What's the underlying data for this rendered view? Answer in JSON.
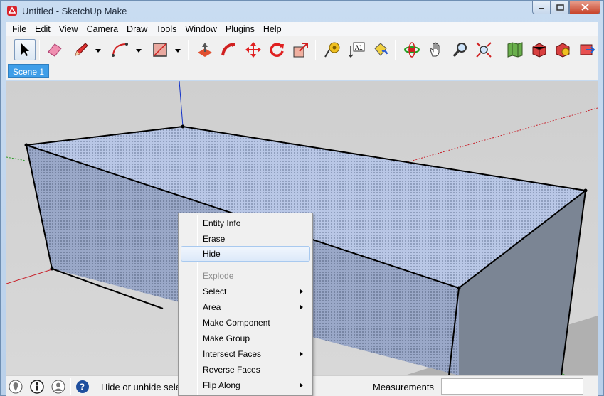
{
  "window": {
    "title": "Untitled - SketchUp Make"
  },
  "menubar": {
    "items": [
      "File",
      "Edit",
      "View",
      "Camera",
      "Draw",
      "Tools",
      "Window",
      "Plugins",
      "Help"
    ]
  },
  "toolbar": {
    "tools": [
      "select-arrow-icon",
      "eraser-icon",
      "pencil-line-icon",
      "arc-icon",
      "rectangle-icon",
      "push-pull-icon",
      "follow-me-icon",
      "move-icon",
      "rotate-icon",
      "scale-icon",
      "tape-measure-icon",
      "text-label-icon",
      "paint-bucket-icon",
      "orbit-icon",
      "pan-hand-icon",
      "zoom-icon",
      "zoom-extents-icon",
      "map-location-icon",
      "get-models-icon",
      "share-model-icon",
      "extension-warehouse-icon"
    ]
  },
  "scenes": {
    "tabs": [
      "Scene 1"
    ]
  },
  "context_menu": {
    "items": [
      {
        "label": "Entity Info",
        "submenu": false,
        "disabled": false,
        "highlighted": false
      },
      {
        "label": "Erase",
        "submenu": false,
        "disabled": false,
        "highlighted": false
      },
      {
        "label": "Hide",
        "submenu": false,
        "disabled": false,
        "highlighted": true
      },
      {
        "label": "Explode",
        "submenu": false,
        "disabled": true,
        "highlighted": false
      },
      {
        "label": "Select",
        "submenu": true,
        "disabled": false,
        "highlighted": false
      },
      {
        "label": "Area",
        "submenu": true,
        "disabled": false,
        "highlighted": false
      },
      {
        "label": "Make Component",
        "submenu": false,
        "disabled": false,
        "highlighted": false
      },
      {
        "label": "Make Group",
        "submenu": false,
        "disabled": false,
        "highlighted": false
      },
      {
        "label": "Intersect Faces",
        "submenu": true,
        "disabled": false,
        "highlighted": false
      },
      {
        "label": "Reverse Faces",
        "submenu": false,
        "disabled": false,
        "highlighted": false
      },
      {
        "label": "Flip Along",
        "submenu": true,
        "disabled": false,
        "highlighted": false
      }
    ]
  },
  "statusbar": {
    "text": "Hide or unhide sele",
    "measurements_label": "Measurements",
    "measurements_value": ""
  },
  "colors": {
    "scene_tab": "#3f9ee8",
    "face_top": "#b9c7e6",
    "face_side": "#7b8594",
    "axis_red": "#c8202a",
    "axis_green": "#2a9a2a",
    "axis_blue": "#1030c8"
  }
}
